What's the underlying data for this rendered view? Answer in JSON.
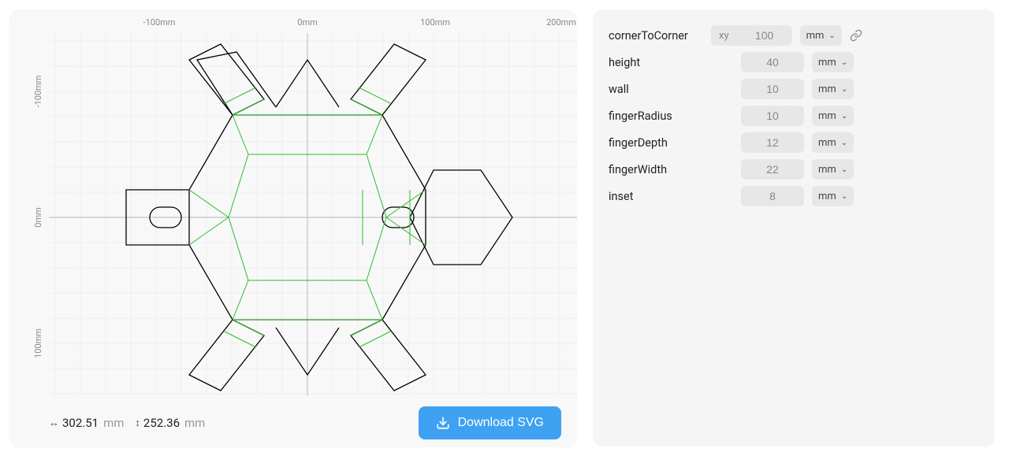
{
  "ruler": {
    "x_labels": [
      "-100mm",
      "0mm",
      "100mm",
      "200mm"
    ],
    "y_labels": [
      "-100mm",
      "0mm",
      "100mm"
    ]
  },
  "dimensions": {
    "width_value": "302.51",
    "width_unit": "mm",
    "height_value": "252.36",
    "height_unit": "mm"
  },
  "buttons": {
    "download": "Download SVG"
  },
  "params": [
    {
      "key": "cornerToCorner",
      "value": "100",
      "unit": "mm",
      "has_xy": true,
      "has_link": true
    },
    {
      "key": "height",
      "value": "40",
      "unit": "mm",
      "has_xy": false,
      "has_link": false
    },
    {
      "key": "wall",
      "value": "10",
      "unit": "mm",
      "has_xy": false,
      "has_link": false
    },
    {
      "key": "fingerRadius",
      "value": "10",
      "unit": "mm",
      "has_xy": false,
      "has_link": false
    },
    {
      "key": "fingerDepth",
      "value": "12",
      "unit": "mm",
      "has_xy": false,
      "has_link": false
    },
    {
      "key": "fingerWidth",
      "value": "22",
      "unit": "mm",
      "has_xy": false,
      "has_link": false
    },
    {
      "key": "inset",
      "value": "8",
      "unit": "mm",
      "has_xy": false,
      "has_link": false
    }
  ],
  "xy_tag": "xy"
}
